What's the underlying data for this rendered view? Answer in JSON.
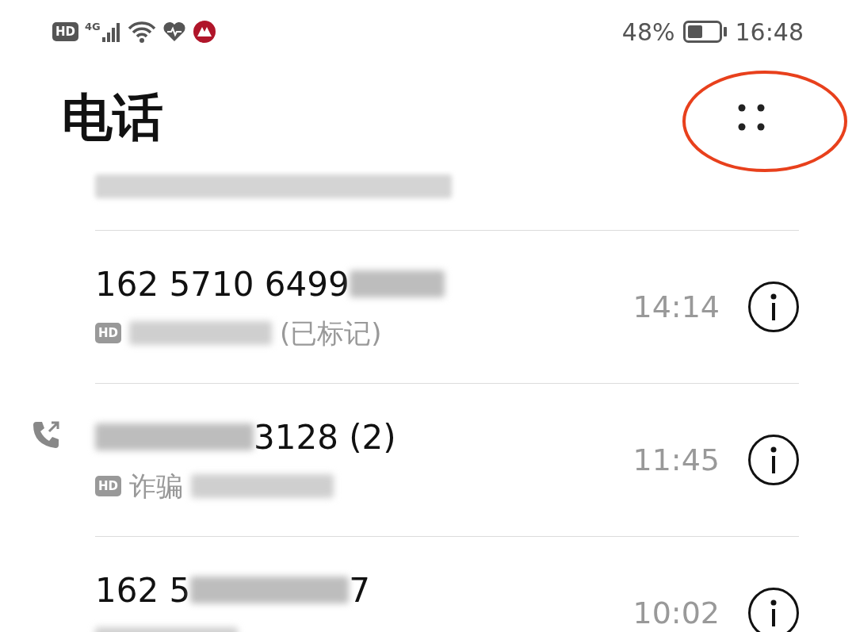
{
  "status_bar": {
    "hd": "HD",
    "network": "4G",
    "battery_percent": "48%",
    "time": "16:48"
  },
  "header": {
    "title": "电话",
    "menu_highlighted": true
  },
  "calls": [
    {
      "kind": "blurred"
    },
    {
      "kind": "call",
      "outgoing": false,
      "hd": "HD",
      "number": "162 5710 6499",
      "subtitle_tail": "(已标记)",
      "time": "14:14"
    },
    {
      "kind": "call",
      "outgoing": true,
      "hd": "HD",
      "number_tail": "3128 (2)",
      "subtitle": "诈骗",
      "time": "11:45"
    },
    {
      "kind": "call",
      "outgoing": false,
      "number": "162 5",
      "number_tail": "7",
      "time": "10:02"
    }
  ]
}
